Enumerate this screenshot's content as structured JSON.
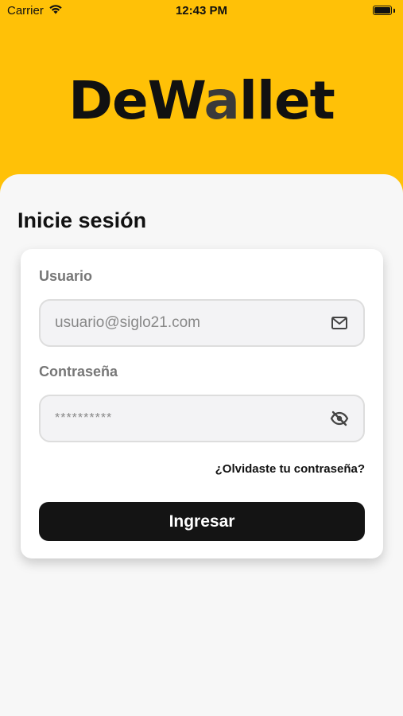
{
  "status_bar": {
    "carrier": "Carrier",
    "time": "12:43 PM"
  },
  "brand": {
    "logo_part1": "DeW",
    "logo_accent": "a",
    "logo_part2": "llet",
    "background_color": "#FFC107"
  },
  "login": {
    "title": "Inicie sesión",
    "username_label": "Usuario",
    "username_value": "usuario@siglo21.com",
    "password_label": "Contraseña",
    "password_value": "**********",
    "forgot_link": "¿Olvidaste tu contraseña?",
    "submit_label": "Ingresar"
  },
  "icons": {
    "username_field": "mail-icon",
    "password_field": "eye-off-icon"
  }
}
